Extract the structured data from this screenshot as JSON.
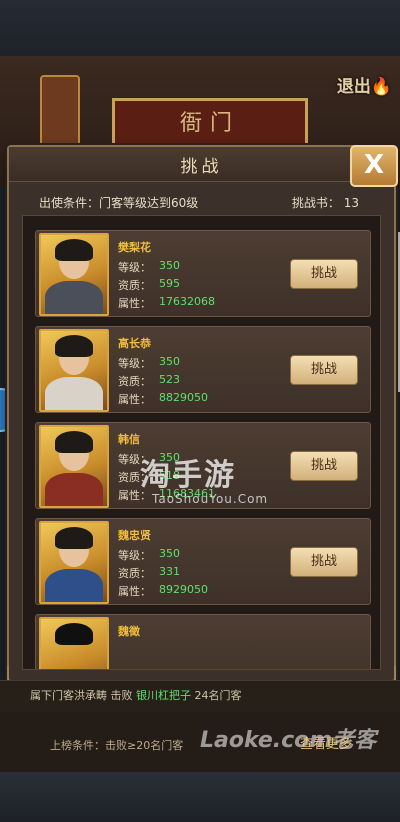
{
  "background": {
    "hall_sign": "衙门",
    "exit_label": "退出"
  },
  "dialog": {
    "title": "挑战",
    "close_label": "X",
    "conditions": "出使条件：门客等级达到60级",
    "ticket_label": "挑战书：",
    "ticket_count": "13"
  },
  "stat_labels": {
    "level": "等级：",
    "quality": "资质：",
    "attribute": "属性："
  },
  "challenge_label": "挑战",
  "retainers": [
    {
      "name": "樊梨花",
      "level": "350",
      "quality": "595",
      "attribute": "17632068"
    },
    {
      "name": "高长恭",
      "level": "350",
      "quality": "523",
      "attribute": "8829050"
    },
    {
      "name": "韩信",
      "level": "350",
      "quality": "518",
      "attribute": "11683461"
    },
    {
      "name": "魏忠贤",
      "level": "350",
      "quality": "331",
      "attribute": "8929050"
    },
    {
      "name": "魏徵"
    }
  ],
  "news": {
    "prefix": "属下门客洪承畴",
    "verb": "击败",
    "target": "银川杠把子",
    "suffix": "24名门客"
  },
  "footer": {
    "upgrade_condition": "上榜条件：击败≥20名门客",
    "more": "查看更多"
  },
  "watermarks": {
    "main": "淘手游",
    "sub": "TaoShouYou.Com",
    "second": "Laoke.com老客"
  },
  "colors": {
    "accent_gold": "#f0bd3c",
    "value_green": "#5fe06c",
    "panel_brown": "#3b302a"
  }
}
